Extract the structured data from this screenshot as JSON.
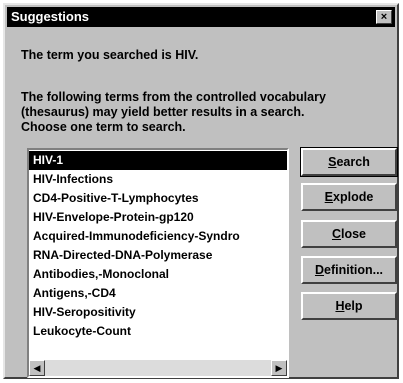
{
  "dialog": {
    "title": "Suggestions",
    "close_glyph": "×",
    "searched_message": "The term you searched is HIV.",
    "instructions": "The following terms from the controlled vocabulary (thesaurus) may yield better results in a search.  Choose one term to search."
  },
  "terms": {
    "selected_index": 0,
    "items": [
      "HIV-1",
      "HIV-Infections",
      "CD4-Positive-T-Lymphocytes",
      "HIV-Envelope-Protein-gp120",
      "Acquired-Immunodeficiency-Syndro",
      "RNA-Directed-DNA-Polymerase",
      "Antibodies,-Monoclonal",
      "Antigens,-CD4",
      "HIV-Seropositivity",
      "Leukocyte-Count"
    ]
  },
  "scrollbar": {
    "left_glyph": "◀",
    "right_glyph": "▶"
  },
  "buttons": {
    "search": {
      "first": "S",
      "rest": "earch"
    },
    "explode": {
      "first": "E",
      "rest": "xplode"
    },
    "close": {
      "first": "C",
      "rest": "lose"
    },
    "definition": {
      "first": "D",
      "rest": "efinition..."
    },
    "help": {
      "first": "H",
      "rest": "elp"
    }
  }
}
